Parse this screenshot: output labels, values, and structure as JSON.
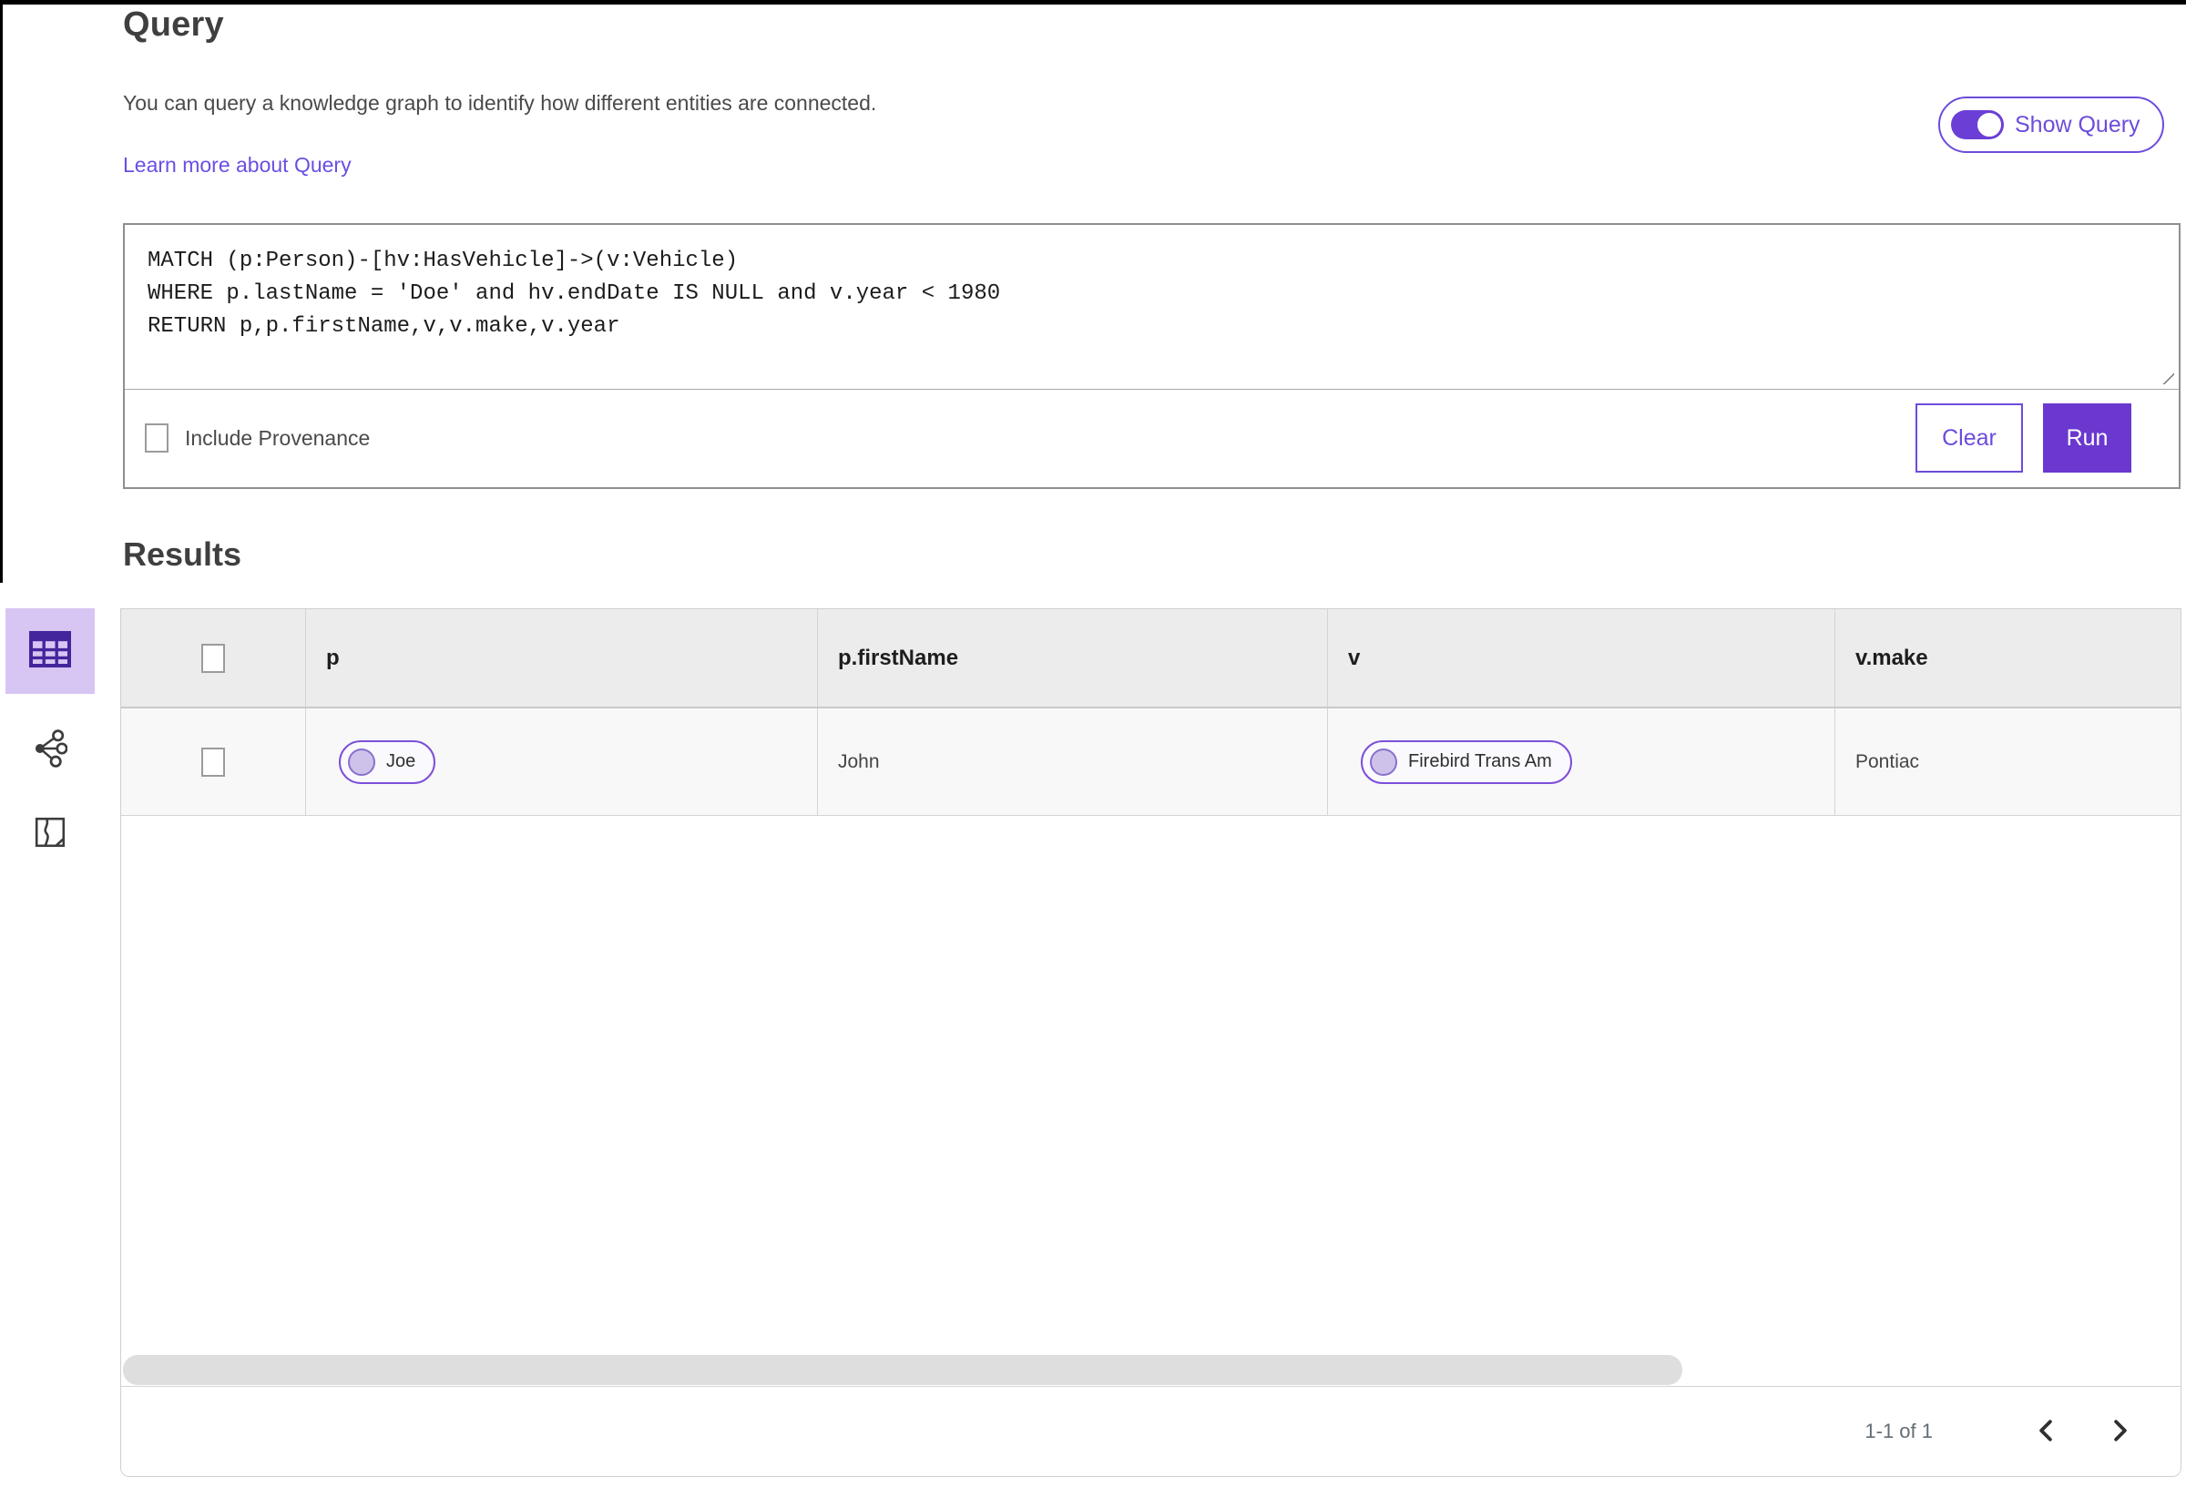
{
  "page": {
    "title": "Query",
    "description": "You can query a knowledge graph to identify how different entities are connected.",
    "learn_more": "Learn more about Query",
    "show_query_label": "Show Query",
    "show_query_on": true
  },
  "query_editor": {
    "text": "MATCH (p:Person)-[hv:HasVehicle]->(v:Vehicle)\nWHERE p.lastName = 'Doe' and hv.endDate IS NULL and v.year < 1980\nRETURN p,p.firstName,v,v.make,v.year",
    "include_provenance_label": "Include Provenance",
    "include_provenance_checked": false,
    "clear_label": "Clear",
    "run_label": "Run"
  },
  "results": {
    "heading": "Results",
    "view_icons": [
      "table-view-icon",
      "link-chart-view-icon",
      "map-view-icon"
    ],
    "selected_view": "table-view-icon",
    "table": {
      "columns": [
        "p",
        "p.firstName",
        "v",
        "v.make"
      ],
      "rows": [
        {
          "selected": false,
          "cells": [
            {
              "kind": "chip",
              "label": "Joe"
            },
            {
              "kind": "text",
              "label": "John"
            },
            {
              "kind": "chip",
              "label": "Firebird Trans Am"
            },
            {
              "kind": "text",
              "label": "Pontiac"
            }
          ]
        }
      ]
    },
    "pagination": {
      "label": "1-1 of 1"
    }
  },
  "colors": {
    "accent": "#6d4cdb",
    "toggle": "#6b3fd6",
    "run": "#6a38cf",
    "chipborder": "#7d4fd9",
    "chipdot": "#cec2ea",
    "chipdotborder": "#8a70cc",
    "tile": "#d7c5f3",
    "tileicon": "#45259c"
  }
}
